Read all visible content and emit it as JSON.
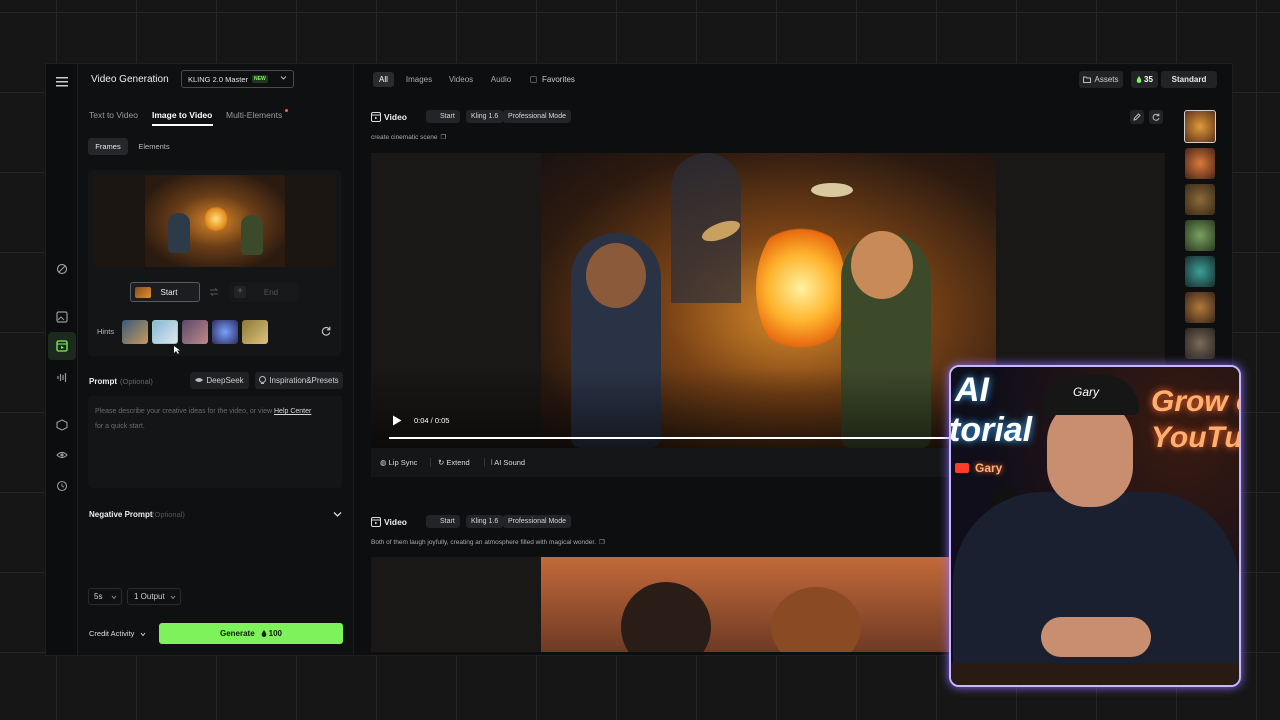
{
  "header": {
    "title": "Video Generation",
    "model": "KLING 2.0 Master",
    "model_badge": "NEW"
  },
  "tabs": [
    {
      "label": "Text to Video",
      "active": false
    },
    {
      "label": "Image to Video",
      "active": true
    },
    {
      "label": "Multi-Elements",
      "active": false
    }
  ],
  "subtabs": [
    {
      "label": "Frames",
      "active": true
    },
    {
      "label": "Elements",
      "active": false
    }
  ],
  "frames": {
    "start_label": "Start",
    "end_label": "End",
    "hints_label": "Hints"
  },
  "prompt": {
    "label": "Prompt",
    "optional": "(Optional)",
    "deepseek_label": "DeepSeek",
    "presets_label": "Inspiration&Presets",
    "placeholder_pre": "Please describe your creative ideas for the video, or view",
    "help_link": "Help Center",
    "placeholder_post": "for a quick start."
  },
  "negative_prompt": {
    "label": "Negative Prompt",
    "optional": "(Optional)"
  },
  "settings": {
    "duration": "5s",
    "outputs": "1 Output"
  },
  "footer": {
    "credit_label": "Credit Activity",
    "generate_label": "Generate",
    "generate_cost": "100"
  },
  "filters": {
    "items": [
      "All",
      "Images",
      "Videos",
      "Audio"
    ],
    "active": "All",
    "favorites_label": "Favorites"
  },
  "topbar": {
    "assets_label": "Assets",
    "credits": "35",
    "plan": "Standard"
  },
  "videos": [
    {
      "label": "Video",
      "chips": [
        "Start",
        "Kling 1.6",
        "Professional Mode"
      ],
      "prompt": "create cinematic scene",
      "time": "0:04 / 0:05",
      "progress": 0.8,
      "actions": [
        "Lip Sync",
        "Extend",
        "AI Sound"
      ]
    },
    {
      "label": "Video",
      "chips": [
        "Start",
        "Kling 1.6",
        "Professional Mode"
      ],
      "prompt": "Both of them laugh joyfully, creating an atmosphere filled with magical wonder."
    }
  ],
  "overlay": {
    "cap_text": "Gary",
    "sign_left_1": "AI",
    "sign_left_2": "torial",
    "sign_right_1": "Grow o",
    "sign_right_2": "YouTul",
    "sign_small": "Gary"
  },
  "colors": {
    "accent_green": "#7ef25a",
    "overlay_border": "#b9a6ff"
  }
}
